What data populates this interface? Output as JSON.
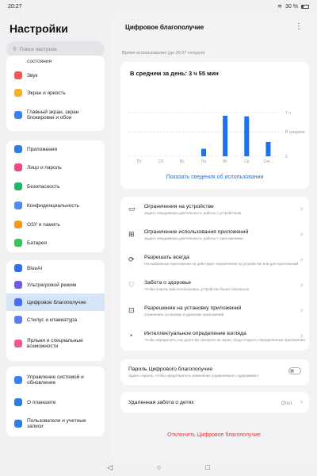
{
  "status": {
    "time": "20:27",
    "battery": "30 %"
  },
  "left": {
    "title": "Настройки",
    "search_placeholder": "Поиск настроек",
    "items": [
      {
        "label": "состояния",
        "icon": "partial",
        "color": "#f29b38"
      },
      {
        "label": "Звук",
        "icon": "sound-icon",
        "color": "#f25a5a"
      },
      {
        "label": "Экран и яркость",
        "icon": "brightness-icon",
        "color": "#f6b12a"
      },
      {
        "label": "Главный экран, экран блокировки и обои",
        "icon": "wallpaper-icon",
        "color": "#3b82f6"
      },
      {
        "label": "Приложения",
        "icon": "apps-icon",
        "color": "#2f7de1"
      },
      {
        "label": "Лицо и пароль",
        "icon": "face-icon",
        "color": "#ef4a7e"
      },
      {
        "label": "Безопасность",
        "icon": "shield-icon",
        "color": "#1fb36b"
      },
      {
        "label": "Конфиденциальность",
        "icon": "privacy-icon",
        "color": "#4d8cf5"
      },
      {
        "label": "ОЗУ и память",
        "icon": "memory-icon",
        "color": "#f39a23"
      },
      {
        "label": "Батарея",
        "icon": "battery-icon",
        "color": "#3cc45a"
      },
      {
        "label": "BlueAI",
        "icon": "ai-icon",
        "color": "#2f6ee8"
      },
      {
        "label": "Ультрагровой режим",
        "icon": "game-icon",
        "color": "#6c5ce7"
      },
      {
        "label": "Цифровое благополучие",
        "icon": "hourglass-icon",
        "color": "#4a6cf0"
      },
      {
        "label": "Стилус и клавиатура",
        "icon": "stylus-icon",
        "color": "#5a7cf2"
      },
      {
        "label": "Ярлыки и специальные возможности",
        "icon": "accessibility-icon",
        "color": "#f05a8a"
      },
      {
        "label": "Управление системой и обновление",
        "icon": "system-icon",
        "color": "#3b82f6"
      },
      {
        "label": "О планшете",
        "icon": "info-icon",
        "color": "#2f7de1"
      },
      {
        "label": "Пользователи и учетные записи",
        "icon": "users-icon",
        "color": "#2f7de1"
      }
    ]
  },
  "right": {
    "title": "Цифровое благополучие",
    "usage_label": "Время использования (до 20:27 сегодня)",
    "average": "В среднем за день: 3 ч 55 мин",
    "link": "Показать сведения об использовании",
    "items": [
      {
        "title": "Ограничения на устройстве",
        "sub": "Задать ежедневную длительность работы с устройством",
        "icon": "device-limit-icon"
      },
      {
        "title": "Ограничение использования приложений",
        "sub": "Задать ежедневную длительность работы с приложением",
        "icon": "app-limit-icon"
      },
      {
        "title": "Разрешать всегда",
        "sub": "На выбранные приложения не действуют ограничения на устройстве или для приложений",
        "icon": "always-allow-icon"
      },
      {
        "title": "Забота о здоровье",
        "sub": "Чтобы помочь вам использовать устройство более безопасно",
        "icon": "heart-icon"
      },
      {
        "title": "Разрешение на установку приложений",
        "sub": "Ограничить установку и удаление приложений",
        "icon": "install-icon"
      },
      {
        "title": "Интеллектуальное определение взгляда",
        "sub": "Чтобы определить, как долго вы смотрите на экран, когда открыты определенные приложения",
        "icon": "gaze-icon"
      }
    ],
    "password": {
      "title": "Пароль Цифрового благополучия",
      "sub": "Задать пароль, чтобы предотвратить изменение управляемого содержимого",
      "enabled": false
    },
    "parental": {
      "title": "Удаленная забота о детях",
      "value": "Откл."
    },
    "disable": "Отключить Цифровое благополучие"
  },
  "chart_data": {
    "type": "bar",
    "categories": [
      "Пт",
      "Сб",
      "Вс",
      "Пн",
      "Вт",
      "Ср",
      "Сег..."
    ],
    "values": [
      0,
      0,
      0,
      1.2,
      6.5,
      6.4,
      2.3
    ],
    "ylim": [
      0,
      7
    ],
    "ticks": [
      {
        "value": 7,
        "label": "7 ч"
      },
      {
        "value": 3.92,
        "label": "В среднем"
      },
      {
        "value": 0,
        "label": "0"
      }
    ],
    "color": "#1a73e8",
    "grid": true
  }
}
